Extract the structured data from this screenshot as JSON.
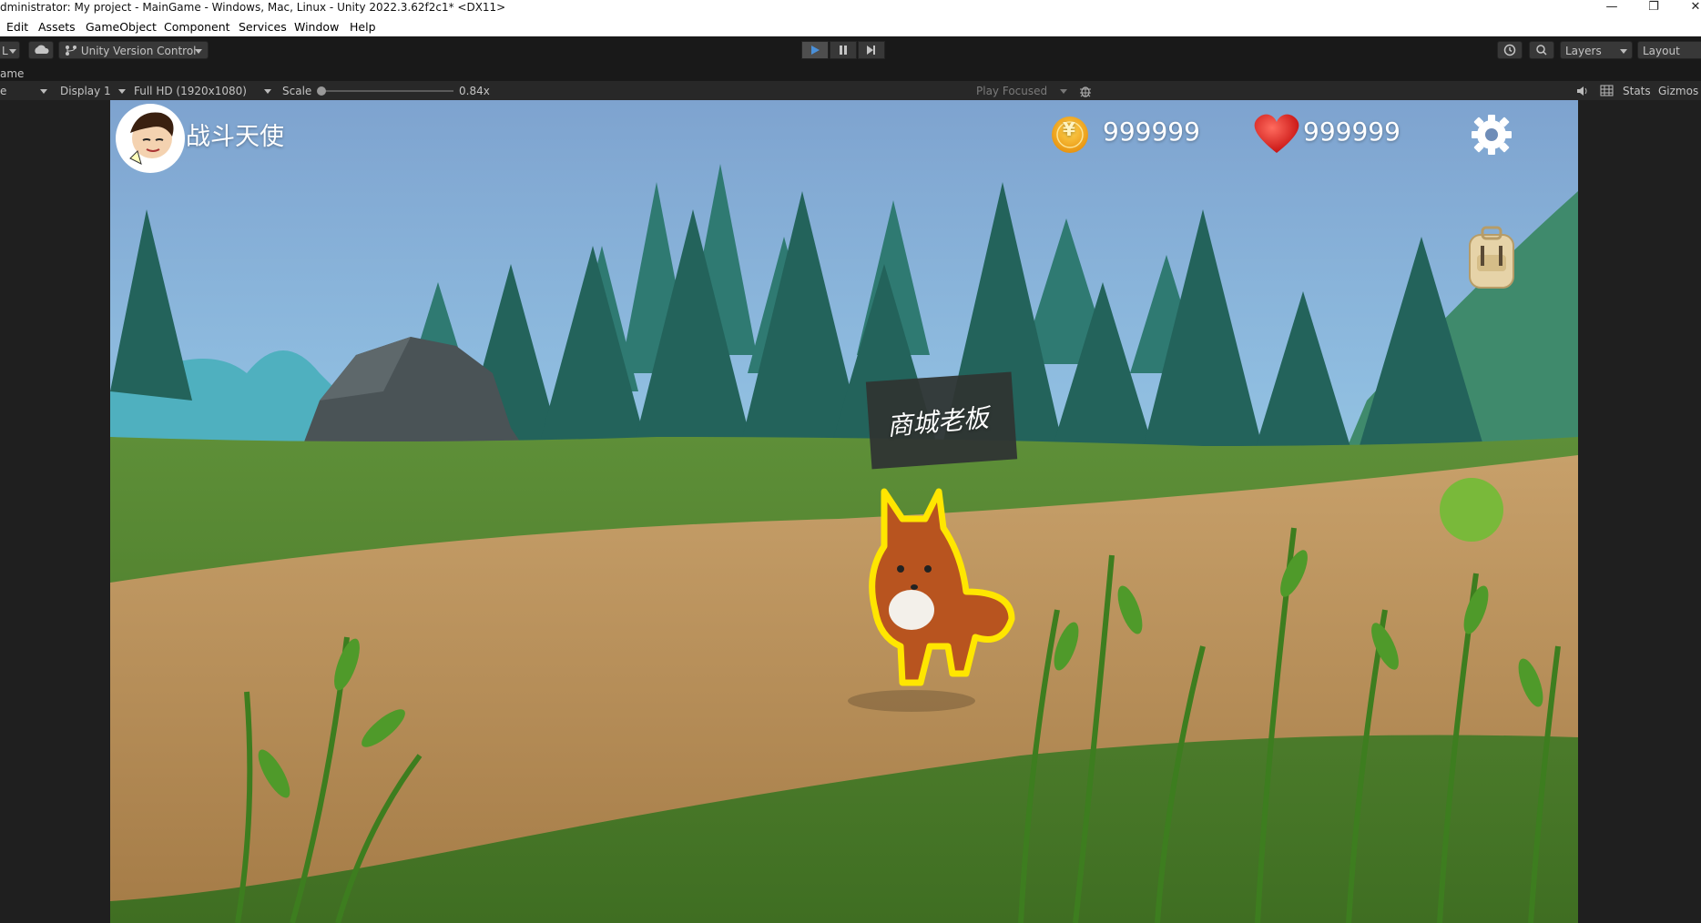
{
  "window": {
    "title": "dministrator: My project - MainGame - Windows, Mac, Linux - Unity 2022.3.62f2c1* <DX11>"
  },
  "menu": {
    "items": [
      "Edit",
      "Assets",
      "GameObject",
      "Component",
      "Services",
      "Window",
      "Help"
    ]
  },
  "toolbar": {
    "account_label": "L",
    "version_control_label": "Unity Version Control",
    "layers_label": "Layers",
    "layout_label": "Layout"
  },
  "tab": {
    "label": "ame"
  },
  "game_toolbar": {
    "mode_label": "e",
    "display_label": "Display 1",
    "resolution_label": "Full HD (1920x1080)",
    "scale_label": "Scale",
    "scale_value": "0.84x",
    "play_focused_label": "Play Focused",
    "stats_label": "Stats",
    "gizmos_label": "Gizmos"
  },
  "hud": {
    "player_name": "战斗天使",
    "coins": "999999",
    "hearts": "999999",
    "coin_symbol": "¥",
    "npc_sign": "商城老板"
  },
  "colors": {
    "accent_play": "#4a90d9",
    "coin_gold": "#f5b21c",
    "heart_red": "#e8201c",
    "fox_outline": "#ffe600"
  }
}
